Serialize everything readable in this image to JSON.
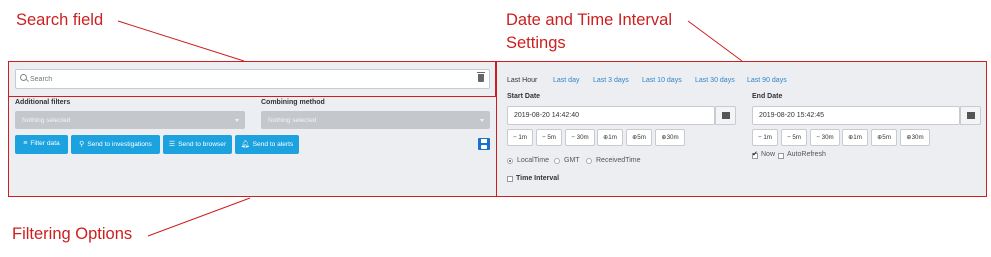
{
  "annotations": {
    "search": "Search field",
    "datetime_line1": "Date and Time Interval",
    "datetime_line2": "Settings",
    "filtering": "Filtering Options"
  },
  "search": {
    "placeholder": "Search",
    "value": ""
  },
  "filters": {
    "additional_label": "Additional filters",
    "additional_value": "Nothing selected",
    "combining_label": "Combining method",
    "combining_value": "Nothing selected",
    "buttons": [
      "Filter data",
      "Send to investigations",
      "Send to browser",
      "Send to alerts"
    ]
  },
  "datetime": {
    "tabs": [
      "Last Hour",
      "Last day",
      "Last 3 days",
      "Last 10 days",
      "Last 30 days",
      "Last 90 days"
    ],
    "active_tab": "Last Hour",
    "start_label": "Start Date",
    "start_value": "2019-08-20 14:42:40",
    "end_label": "End Date",
    "end_value": "2019-08-20 15:42:45",
    "steps": [
      "1m",
      "5m",
      "30m",
      "1m",
      "5m",
      "30m"
    ],
    "timezone_options": [
      "LocalTime",
      "GMT",
      "ReceivedTime"
    ],
    "timezone_selected": "LocalTime",
    "time_interval_label": "Time Interval",
    "now_label": "Now",
    "now_checked": true,
    "autorefresh_label": "AutoRefresh",
    "autorefresh_checked": false
  },
  "colors": {
    "annotation": "#cc1f1f",
    "button": "#1ca3df",
    "link": "#2e86c9",
    "panel": "#eceef1"
  }
}
